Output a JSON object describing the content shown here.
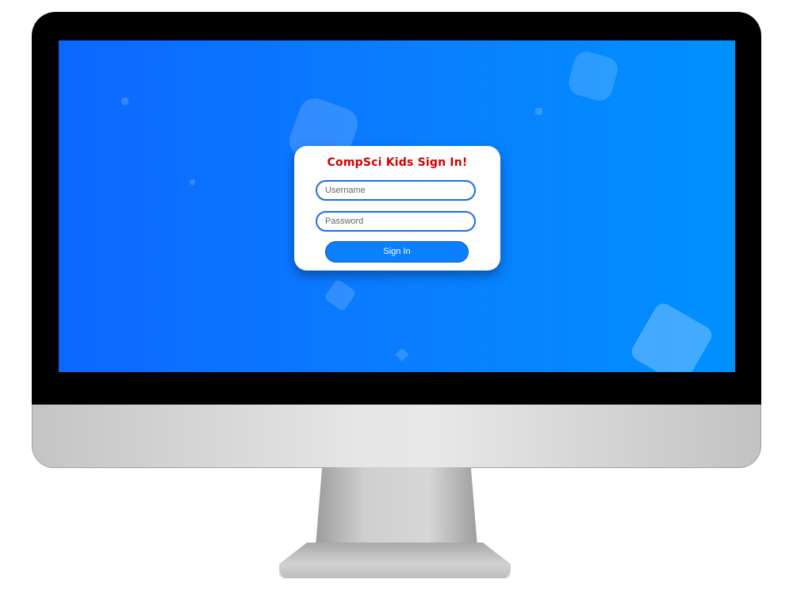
{
  "signin_card": {
    "title": "CompSci Kids Sign In!",
    "username_placeholder": "Username",
    "password_placeholder": "Password",
    "submit_label": "Sign In"
  },
  "colors": {
    "screen_gradient_start": "#0c67ff",
    "screen_gradient_end": "#0090ff",
    "title_color": "#d40000",
    "button_color": "#0b80ff",
    "field_border": "#1a6ee8"
  }
}
